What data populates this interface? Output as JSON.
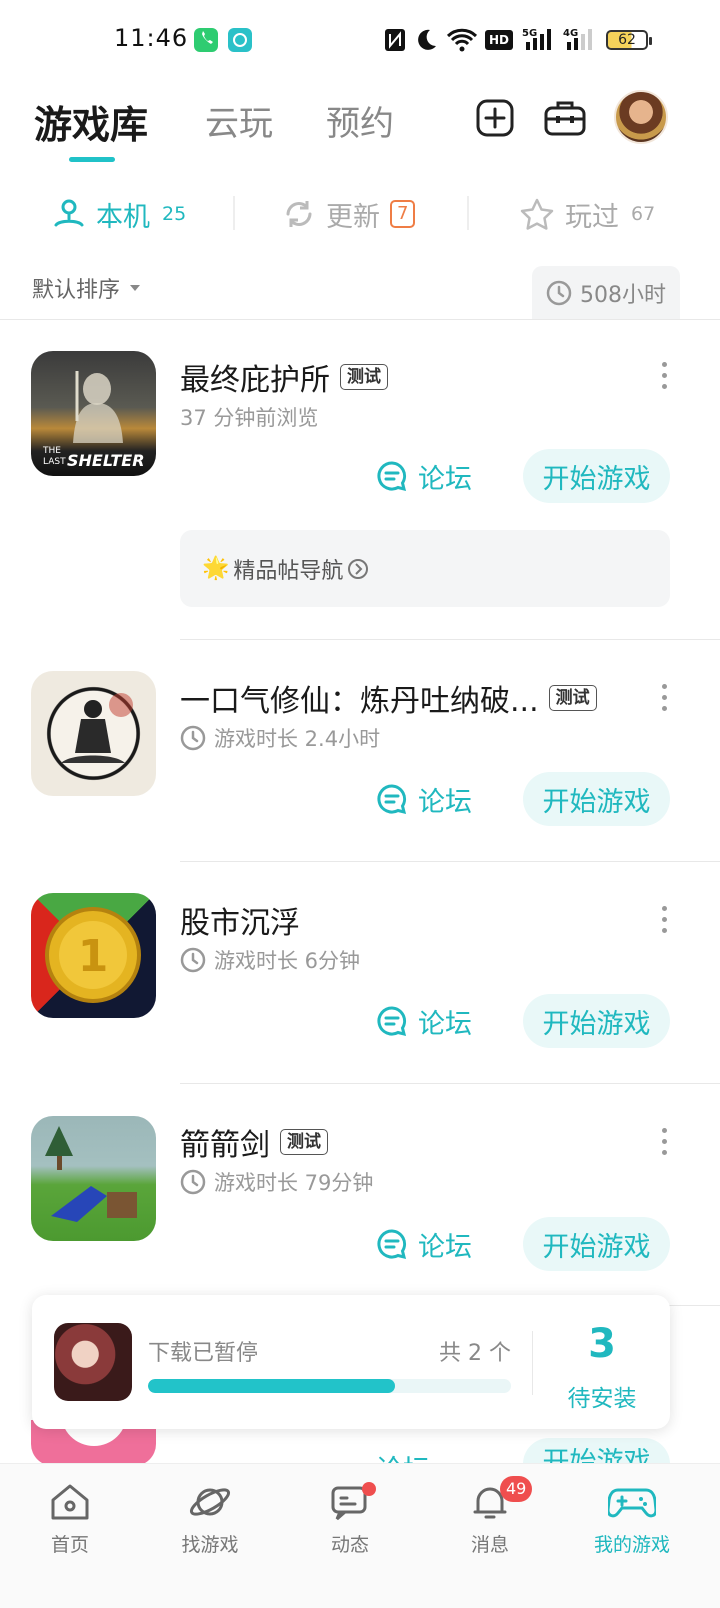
{
  "status_bar": {
    "time": "11:46",
    "battery": "62",
    "icons": [
      "phone-icon",
      "chat-icon",
      "nfc-icon",
      "moon-icon",
      "wifi-icon",
      "hd-icon",
      "5g-signal-icon",
      "4g-signal-icon",
      "battery-icon"
    ]
  },
  "header": {
    "tabs": [
      {
        "label": "游戏库",
        "active": true
      },
      {
        "label": "云玩",
        "active": false
      },
      {
        "label": "预约",
        "active": false
      }
    ],
    "icons": [
      "add-icon",
      "toolbox-icon",
      "avatar"
    ]
  },
  "subtabs": {
    "local": {
      "label": "本机",
      "count": "25"
    },
    "update": {
      "label": "更新",
      "count": "7"
    },
    "played": {
      "label": "玩过",
      "count": "67"
    }
  },
  "sort": {
    "label": "默认排序",
    "hours": "508小时"
  },
  "colors": {
    "accent": "#20b8bf",
    "badge_orange": "#ef7d45",
    "red": "#ef4e4e"
  },
  "games": [
    {
      "title": "最终庇护所",
      "tag": "测试",
      "subtitle": "37 分钟前浏览",
      "forum": "论坛",
      "play": "开始游戏"
    },
    {
      "title": "一口气修仙：炼丹吐纳破...",
      "tag": "测试",
      "subtitle": "游戏时长 2.4小时",
      "forum": "论坛",
      "play": "开始游戏"
    },
    {
      "title": "股市沉浮",
      "tag": "",
      "subtitle": "游戏时长 6分钟",
      "forum": "论坛",
      "play": "开始游戏"
    },
    {
      "title": "箭箭剑",
      "tag": "测试",
      "subtitle": "游戏时长 79分钟",
      "forum": "论坛",
      "play": "开始游戏"
    }
  ],
  "game0_icon_text": {
    "line1": "THE",
    "line2": "LAST",
    "line3": "SHELTER"
  },
  "nav_card": {
    "label": "精品帖导航",
    "emoji": "🌟"
  },
  "download": {
    "status": "下载已暂停",
    "total": "共 2 个",
    "progress": 0.68,
    "pending_count": "3",
    "pending_label": "待安装"
  },
  "peek_item": {
    "forum": "论坛",
    "play": "开始游戏"
  },
  "bottom_nav": [
    {
      "label": "首页",
      "icon": "home-icon"
    },
    {
      "label": "找游戏",
      "icon": "planet-icon"
    },
    {
      "label": "动态",
      "icon": "chat-bubble-icon"
    },
    {
      "label": "消息",
      "icon": "bell-icon",
      "badge": "49"
    },
    {
      "label": "我的游戏",
      "icon": "gamepad-icon",
      "active": true
    }
  ]
}
